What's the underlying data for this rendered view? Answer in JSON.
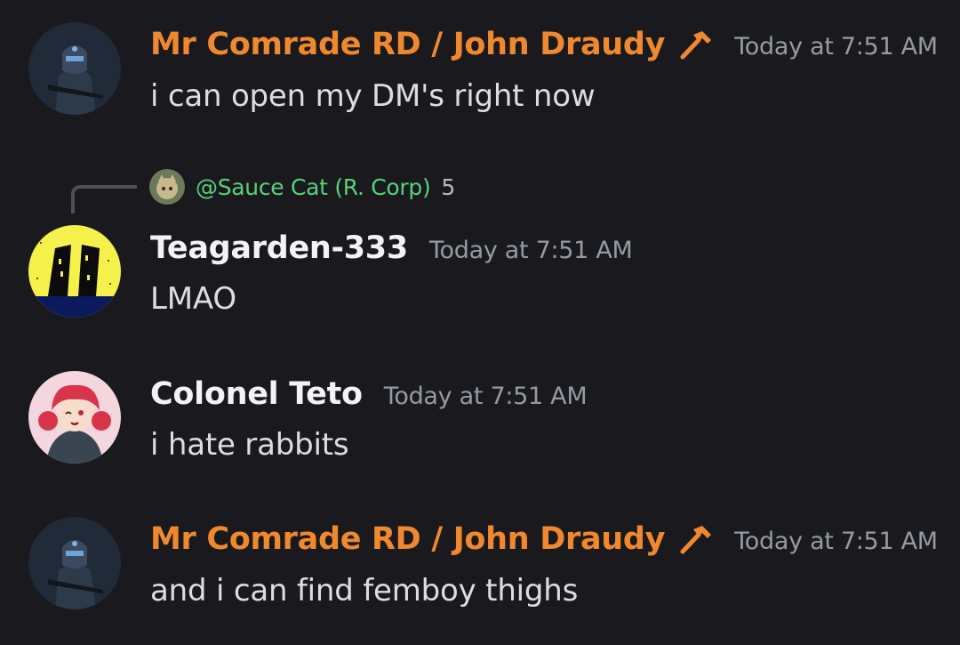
{
  "messages": [
    {
      "author": "Mr Comrade RD / John Draudy",
      "timestamp": "Today at 7:51 AM",
      "content": "i can open my DM's right now",
      "name_color": "#f0882e",
      "role_icon": "hammer-icon"
    },
    {
      "reply": {
        "mention": "@Sauce Cat (R. Corp)",
        "preview": "5",
        "mention_color": "#57d17a"
      },
      "author": "Teagarden-333",
      "timestamp": "Today at 7:51 AM",
      "content": "LMAO",
      "name_color": "#f2f3f5"
    },
    {
      "author": "Colonel Teto",
      "timestamp": "Today at 7:51 AM",
      "content": "i hate rabbits",
      "name_color": "#f2f3f5"
    },
    {
      "author": "Mr Comrade RD / John Draudy",
      "timestamp": "Today at 7:51 AM",
      "content": "and i can find femboy thighs",
      "name_color": "#f0882e",
      "role_icon": "hammer-icon"
    }
  ],
  "theme": {
    "background": "#1a1a1e",
    "timestamp_color": "#949ba4",
    "text_color": "#dbdee1"
  }
}
